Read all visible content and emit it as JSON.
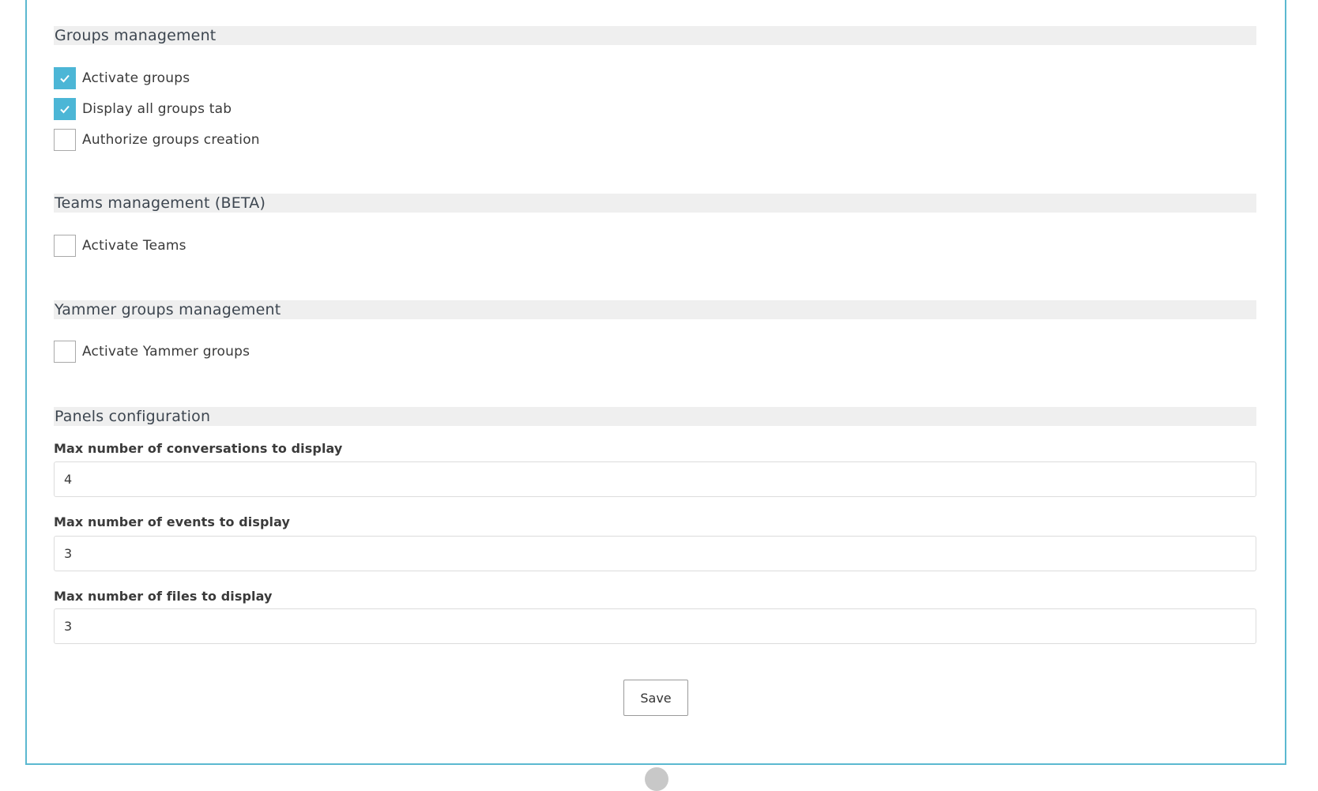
{
  "sections": {
    "groups": {
      "title": "Groups management",
      "options": [
        {
          "label": "Activate groups",
          "checked": true
        },
        {
          "label": "Display all groups tab",
          "checked": true
        },
        {
          "label": "Authorize groups creation",
          "checked": false
        }
      ]
    },
    "teams": {
      "title": "Teams management (BETA)",
      "options": [
        {
          "label": "Activate Teams",
          "checked": false
        }
      ]
    },
    "yammer": {
      "title": "Yammer groups management",
      "options": [
        {
          "label": "Activate Yammer groups",
          "checked": false
        }
      ]
    },
    "panels": {
      "title": "Panels configuration",
      "fields": [
        {
          "label": "Max number of conversations to display",
          "value": "4"
        },
        {
          "label": "Max number of events to display",
          "value": "3"
        },
        {
          "label": "Max number of files to display",
          "value": "3"
        }
      ]
    }
  },
  "actions": {
    "save_label": "Save"
  },
  "colors": {
    "accent": "#4cb6d6",
    "panel_border": "#5bb8d0",
    "section_header_bg": "#efefef"
  }
}
